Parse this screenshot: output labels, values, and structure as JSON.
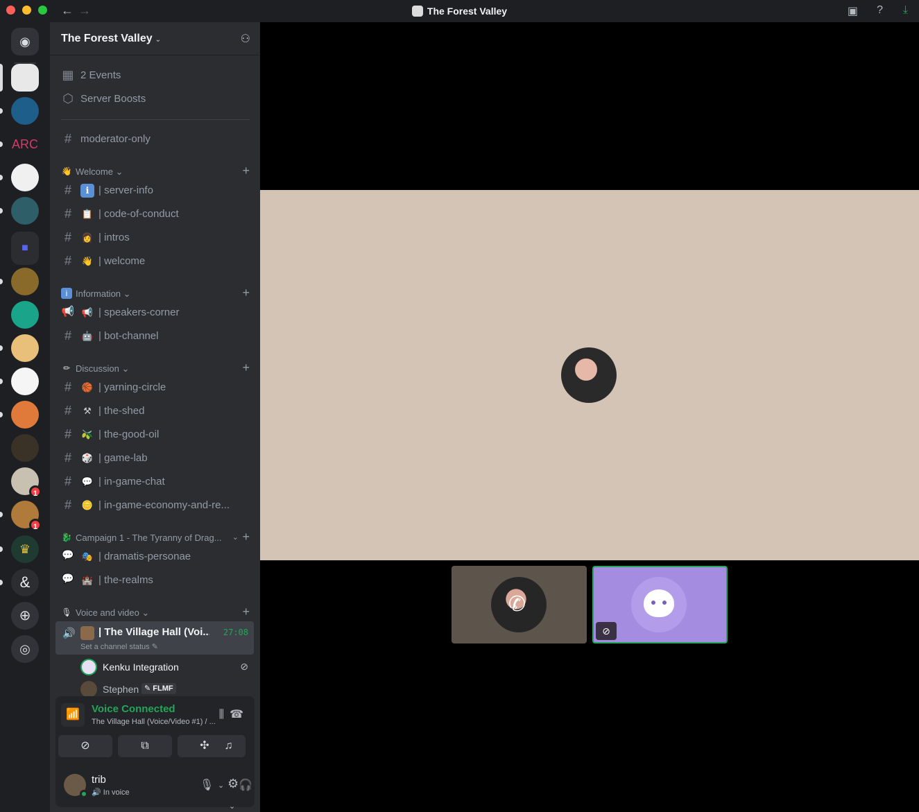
{
  "window": {
    "title": "The Forest Valley"
  },
  "server": {
    "name": "The Forest Valley"
  },
  "colors": {
    "accent": "#5865f2",
    "online": "#23a55a",
    "sidebar": "#2b2d31",
    "rail": "#1e1f22",
    "stage_tile": "#d3c4b5",
    "bot_tile": "#a48ce0"
  },
  "rail": {
    "badges": [
      "1",
      "1"
    ]
  },
  "top_items": [
    {
      "icon": "calendar-icon",
      "label": "2 Events"
    },
    {
      "icon": "boost-icon",
      "label": "Server Boosts"
    }
  ],
  "moderator_channel": {
    "label": "moderator-only"
  },
  "categories": {
    "welcome": {
      "label": "Welcome",
      "channels": [
        {
          "emoji": "ℹ",
          "label": "server-info"
        },
        {
          "emoji": "📋",
          "label": "code-of-conduct"
        },
        {
          "emoji": "👩",
          "label": "intros"
        },
        {
          "emoji": "👋",
          "label": "welcome"
        }
      ]
    },
    "information": {
      "label": "Information",
      "channels": [
        {
          "emoji": "📢",
          "label": "speakers-corner"
        },
        {
          "emoji": "🤖",
          "label": "bot-channel"
        }
      ]
    },
    "discussion": {
      "label": "Discussion",
      "channels": [
        {
          "emoji": "🏀",
          "label": "yarning-circle"
        },
        {
          "emoji": "⚒",
          "label": "the-shed"
        },
        {
          "emoji": "🫒",
          "label": "the-good-oil"
        },
        {
          "emoji": "🎲",
          "label": "game-lab"
        },
        {
          "emoji": "💬",
          "label": "in-game-chat"
        },
        {
          "emoji": "🪙",
          "label": "in-game-economy-and-re..."
        }
      ]
    },
    "campaign": {
      "label": "Campaign 1 - The Tyranny of Drag...",
      "channels": [
        {
          "emoji": "🎭",
          "label": "dramatis-personae"
        },
        {
          "emoji": "🏰",
          "label": "the-realms"
        }
      ]
    },
    "voice": {
      "label": "Voice and video"
    }
  },
  "active_voice_channel": {
    "name": "The Village Hall (Voi...",
    "timer": "27:08",
    "status": "Set a channel status"
  },
  "voice_users": [
    {
      "name": "Kenku Integration"
    },
    {
      "name": "Stephen",
      "tag": "FLMF"
    }
  ],
  "voice_panel": {
    "title": "Voice Connected",
    "subtitle": "The Village Hall (Voice/Video #1) / ..."
  },
  "user": {
    "name": "trib",
    "status": "In voice"
  }
}
